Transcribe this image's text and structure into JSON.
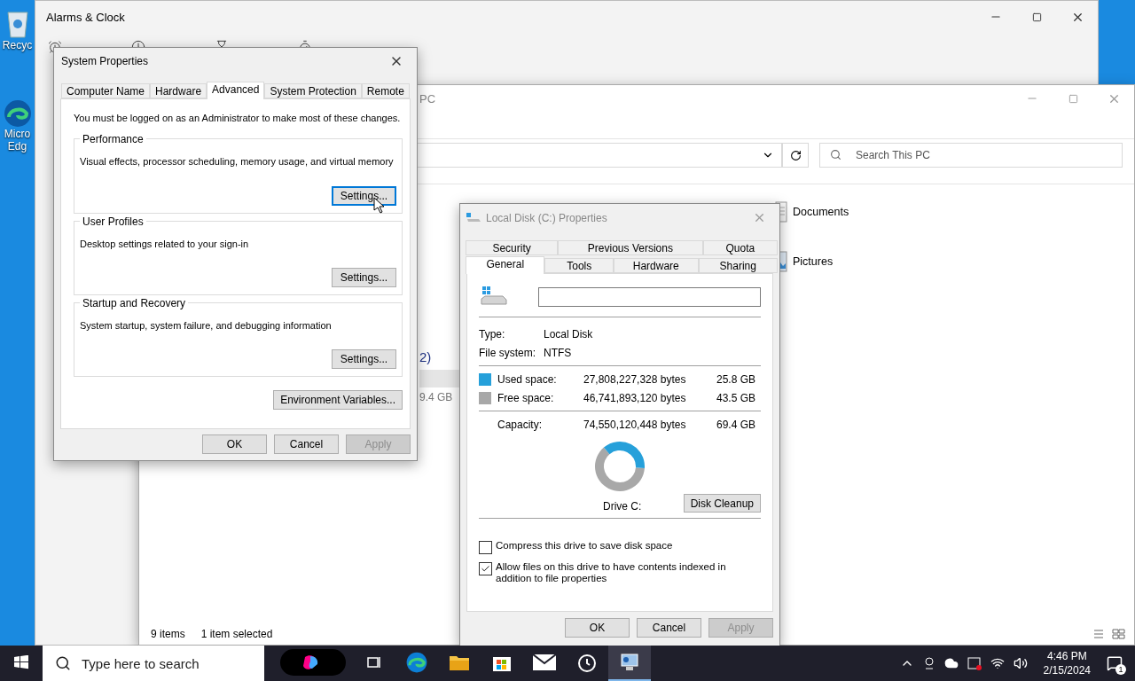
{
  "desktop": {
    "icons": [
      {
        "label": "Recyc",
        "kind": "recycle"
      },
      {
        "label": "Micro\nEdg",
        "kind": "edge"
      }
    ]
  },
  "alarms_window": {
    "title": "Alarms & Clock",
    "tabs": [
      {
        "kind": "alarm"
      },
      {
        "kind": "clock"
      },
      {
        "kind": "timer"
      },
      {
        "kind": "stopwatch"
      }
    ]
  },
  "explorer_window": {
    "title": "PC",
    "search": {
      "placeholder": "Search This PC"
    },
    "items": [
      {
        "label": "Documents",
        "kind": "documents"
      },
      {
        "label": "Pictures",
        "kind": "pictures"
      }
    ],
    "group_heading": "2)",
    "drive_size": "9.4 GB",
    "status_bar": {
      "count": "9 items",
      "selection": "1 item selected"
    }
  },
  "system_properties": {
    "title": "System Properties",
    "tabs": [
      {
        "label": "Computer Name",
        "selected": false
      },
      {
        "label": "Hardware",
        "selected": false
      },
      {
        "label": "Advanced",
        "selected": true
      },
      {
        "label": "System Protection",
        "selected": false
      },
      {
        "label": "Remote",
        "selected": false
      }
    ],
    "note": "You must be logged on as an Administrator to make most of these changes.",
    "groups": [
      {
        "title": "Performance",
        "description": "Visual effects, processor scheduling, memory usage, and virtual memory",
        "button": {
          "label": "Settings...",
          "focused": true
        }
      },
      {
        "title": "User Profiles",
        "description": "Desktop settings related to your sign-in",
        "button": {
          "label": "Settings...",
          "focused": false
        }
      },
      {
        "title": "Startup and Recovery",
        "description": "System startup, system failure, and debugging information",
        "button": {
          "label": "Settings...",
          "focused": false
        }
      }
    ],
    "env_button": "Environment Variables...",
    "buttons": [
      {
        "label": "OK",
        "disabled": false
      },
      {
        "label": "Cancel",
        "disabled": false
      },
      {
        "label": "Apply",
        "disabled": true
      }
    ]
  },
  "disk_properties": {
    "title": "Local Disk (C:) Properties",
    "tab_rows": [
      [
        {
          "label": "Security",
          "selected": false
        },
        {
          "label": "Previous Versions",
          "selected": false
        },
        {
          "label": "Quota",
          "selected": false
        }
      ],
      [
        {
          "label": "General",
          "selected": true
        },
        {
          "label": "Tools",
          "selected": false
        },
        {
          "label": "Hardware",
          "selected": false
        },
        {
          "label": "Sharing",
          "selected": false
        }
      ]
    ],
    "info": [
      {
        "label": "Type:",
        "value": "Local Disk"
      },
      {
        "label": "File system:",
        "value": "NTFS"
      }
    ],
    "space": [
      {
        "label": "Used space:",
        "bytes": "27,808,227,328 bytes",
        "size": "25.8 GB",
        "color": "#26a0da"
      },
      {
        "label": "Free space:",
        "bytes": "46,741,893,120 bytes",
        "size": "43.5 GB",
        "color": "#a8a8a8"
      }
    ],
    "capacity": {
      "label": "Capacity:",
      "bytes": "74,550,120,448 bytes",
      "size": "69.4 GB"
    },
    "usage": {
      "caption": "Drive C:"
    },
    "cleanup_button": "Disk Cleanup",
    "options": [
      {
        "label": "Compress this drive to save disk space",
        "checked": false
      },
      {
        "label": "Allow files on this drive to have contents indexed in addition to file properties",
        "checked": true
      }
    ],
    "buttons": [
      {
        "label": "OK",
        "disabled": false
      },
      {
        "label": "Cancel",
        "disabled": false
      },
      {
        "label": "Apply",
        "disabled": true
      }
    ]
  },
  "taskbar": {
    "search": {
      "placeholder": "Type here to search"
    },
    "apps": [
      {
        "kind": "copilot",
        "selected": false
      },
      {
        "kind": "taskview",
        "selected": false
      },
      {
        "kind": "edge",
        "selected": false
      },
      {
        "kind": "explorer",
        "selected": false
      },
      {
        "kind": "store",
        "selected": false
      },
      {
        "kind": "mail",
        "selected": false
      },
      {
        "kind": "clock",
        "selected": false
      },
      {
        "kind": "system",
        "selected": true
      }
    ],
    "time": "4:46 PM",
    "date": "2/15/2024",
    "notifications": "1"
  }
}
